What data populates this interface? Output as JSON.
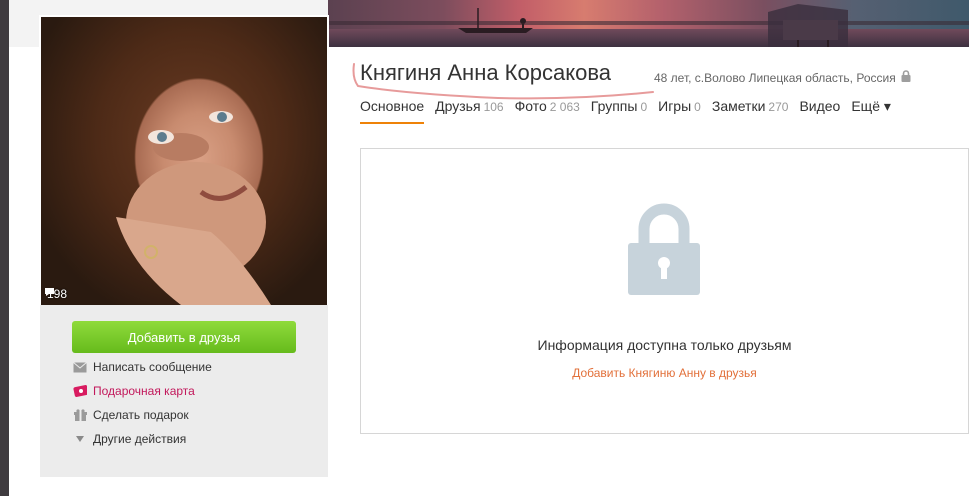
{
  "profile": {
    "name": "Княгиня Анна Корсакова",
    "meta": "48 лет, с.Волово Липецкая область, Россия",
    "comment_count": "198"
  },
  "tabs": [
    {
      "label": "Основное",
      "count": ""
    },
    {
      "label": "Друзья",
      "count": "106"
    },
    {
      "label": "Фото",
      "count": "2 063"
    },
    {
      "label": "Группы",
      "count": "0"
    },
    {
      "label": "Игры",
      "count": "0"
    },
    {
      "label": "Заметки",
      "count": "270"
    },
    {
      "label": "Видео",
      "count": ""
    },
    {
      "label": "Ещё ▾",
      "count": ""
    }
  ],
  "actions": {
    "add_friend": "Добавить в друзья",
    "write_message": "Написать сообщение",
    "gift_card": "Подарочная карта",
    "make_gift": "Сделать подарок",
    "other_actions": "Другие действия"
  },
  "content": {
    "private_text": "Информация доступна только друзьям",
    "add_link": "Добавить Княгиню Анну в друзья"
  },
  "colors": {
    "accent": "#ee8208",
    "button_green": "#66bb1c",
    "link_orange": "#e2703a",
    "lock_gray": "#c7d3db"
  },
  "icons": {
    "comment": "speech-bubble-icon",
    "privacy": "lock-icon",
    "message": "envelope-icon",
    "gift_card": "gift-card-icon",
    "gift": "gift-box-icon",
    "more": "triangle-down-icon"
  }
}
